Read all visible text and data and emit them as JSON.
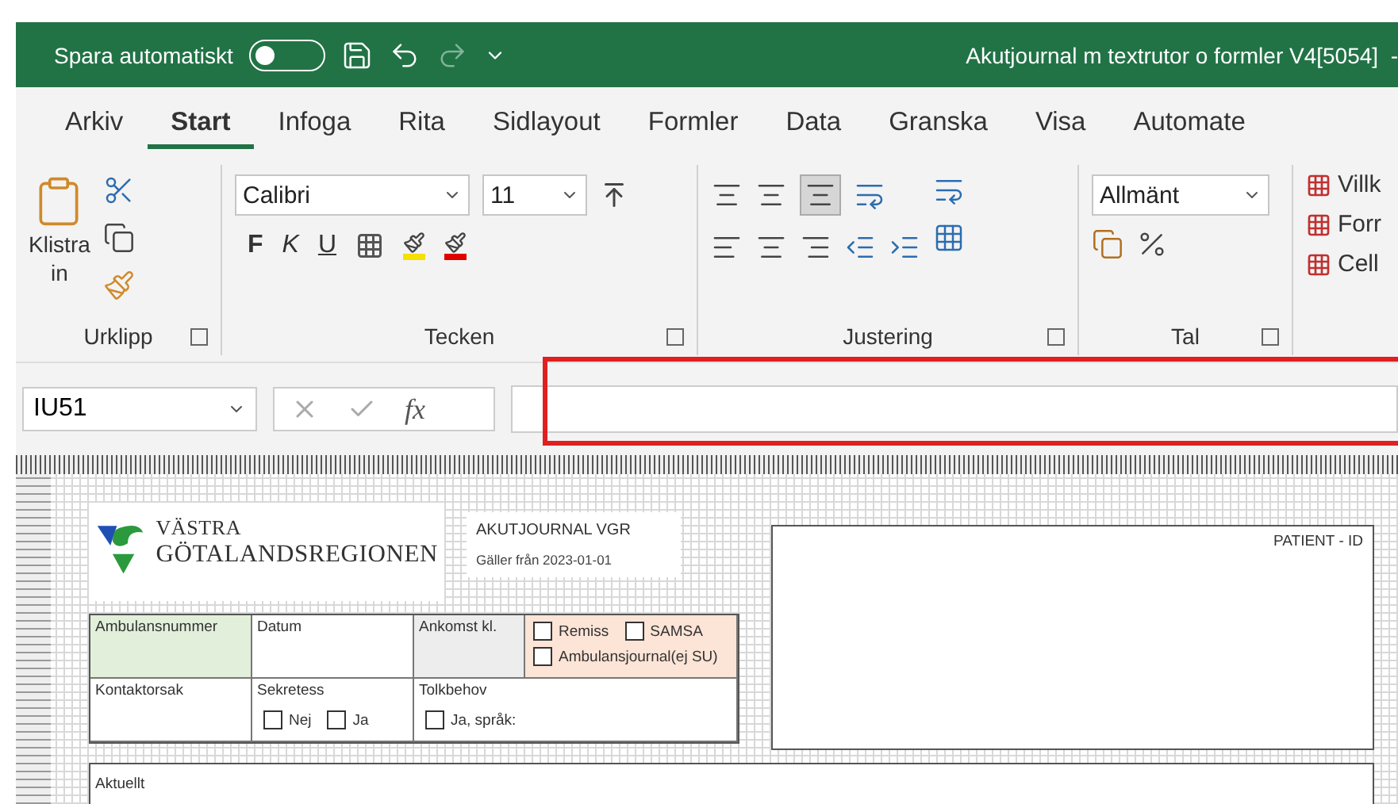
{
  "title_bar": {
    "autosave_label": "Spara automatiskt",
    "autosave_on": false,
    "document_title": "Akutjournal m textrutor o formler V4[5054]  -"
  },
  "ribbon_tabs": [
    {
      "label": "Arkiv",
      "selected": false
    },
    {
      "label": "Start",
      "selected": true
    },
    {
      "label": "Infoga",
      "selected": false
    },
    {
      "label": "Rita",
      "selected": false
    },
    {
      "label": "Sidlayout",
      "selected": false
    },
    {
      "label": "Formler",
      "selected": false
    },
    {
      "label": "Data",
      "selected": false
    },
    {
      "label": "Granska",
      "selected": false
    },
    {
      "label": "Visa",
      "selected": false
    },
    {
      "label": "Automate",
      "selected": false
    }
  ],
  "ribbon": {
    "clipboard": {
      "paste_label": "Klistra",
      "paste_sub": "in",
      "group": "Urklipp"
    },
    "font": {
      "name": "Calibri",
      "size": "11",
      "bold": "F",
      "italic": "K",
      "underline": "U",
      "group": "Tecken"
    },
    "alignment": {
      "group": "Justering"
    },
    "number": {
      "format": "Allmänt",
      "group": "Tal"
    },
    "styles": [
      "Villk",
      "Forr",
      "Cell"
    ]
  },
  "formula_bar": {
    "cell_ref": "IU51",
    "fx": "fx",
    "highlighted": true
  },
  "sheet": {
    "logo": {
      "line1": "VÄSTRA",
      "line2": "GÖTALANDSREGIONEN"
    },
    "header": {
      "title": "AKUTJOURNAL VGR",
      "valid_from": "Gäller från 2023-01-01"
    },
    "patient_id": "PATIENT - ID",
    "form_rows": [
      {
        "cells": [
          {
            "label": "Ambulansnummer",
            "color": "#e2efda"
          },
          {
            "label": "Datum",
            "color": "#ffffff"
          },
          {
            "label": "Ankomst kl.",
            "color": "#ededed"
          },
          {
            "color": "#fce4d6",
            "checkboxes": [
              {
                "label": "Remiss",
                "checked": false
              },
              {
                "label": "SAMSA",
                "checked": false
              },
              {
                "label": "Ambulansjournal(ej SU)",
                "checked": false
              }
            ]
          }
        ]
      },
      {
        "cells": [
          {
            "label": "Kontaktorsak",
            "color": "#ffffff"
          },
          {
            "label": "Sekretess",
            "color": "#ffffff",
            "checkboxes": [
              {
                "label": "Nej",
                "checked": false
              },
              {
                "label": "Ja",
                "checked": false
              }
            ]
          },
          {
            "label": "Tolkbehov",
            "color": "#ffffff",
            "checkboxes": [
              {
                "label": "Ja, språk:",
                "checked": false
              }
            ]
          }
        ]
      }
    ],
    "section": "Aktuellt"
  }
}
